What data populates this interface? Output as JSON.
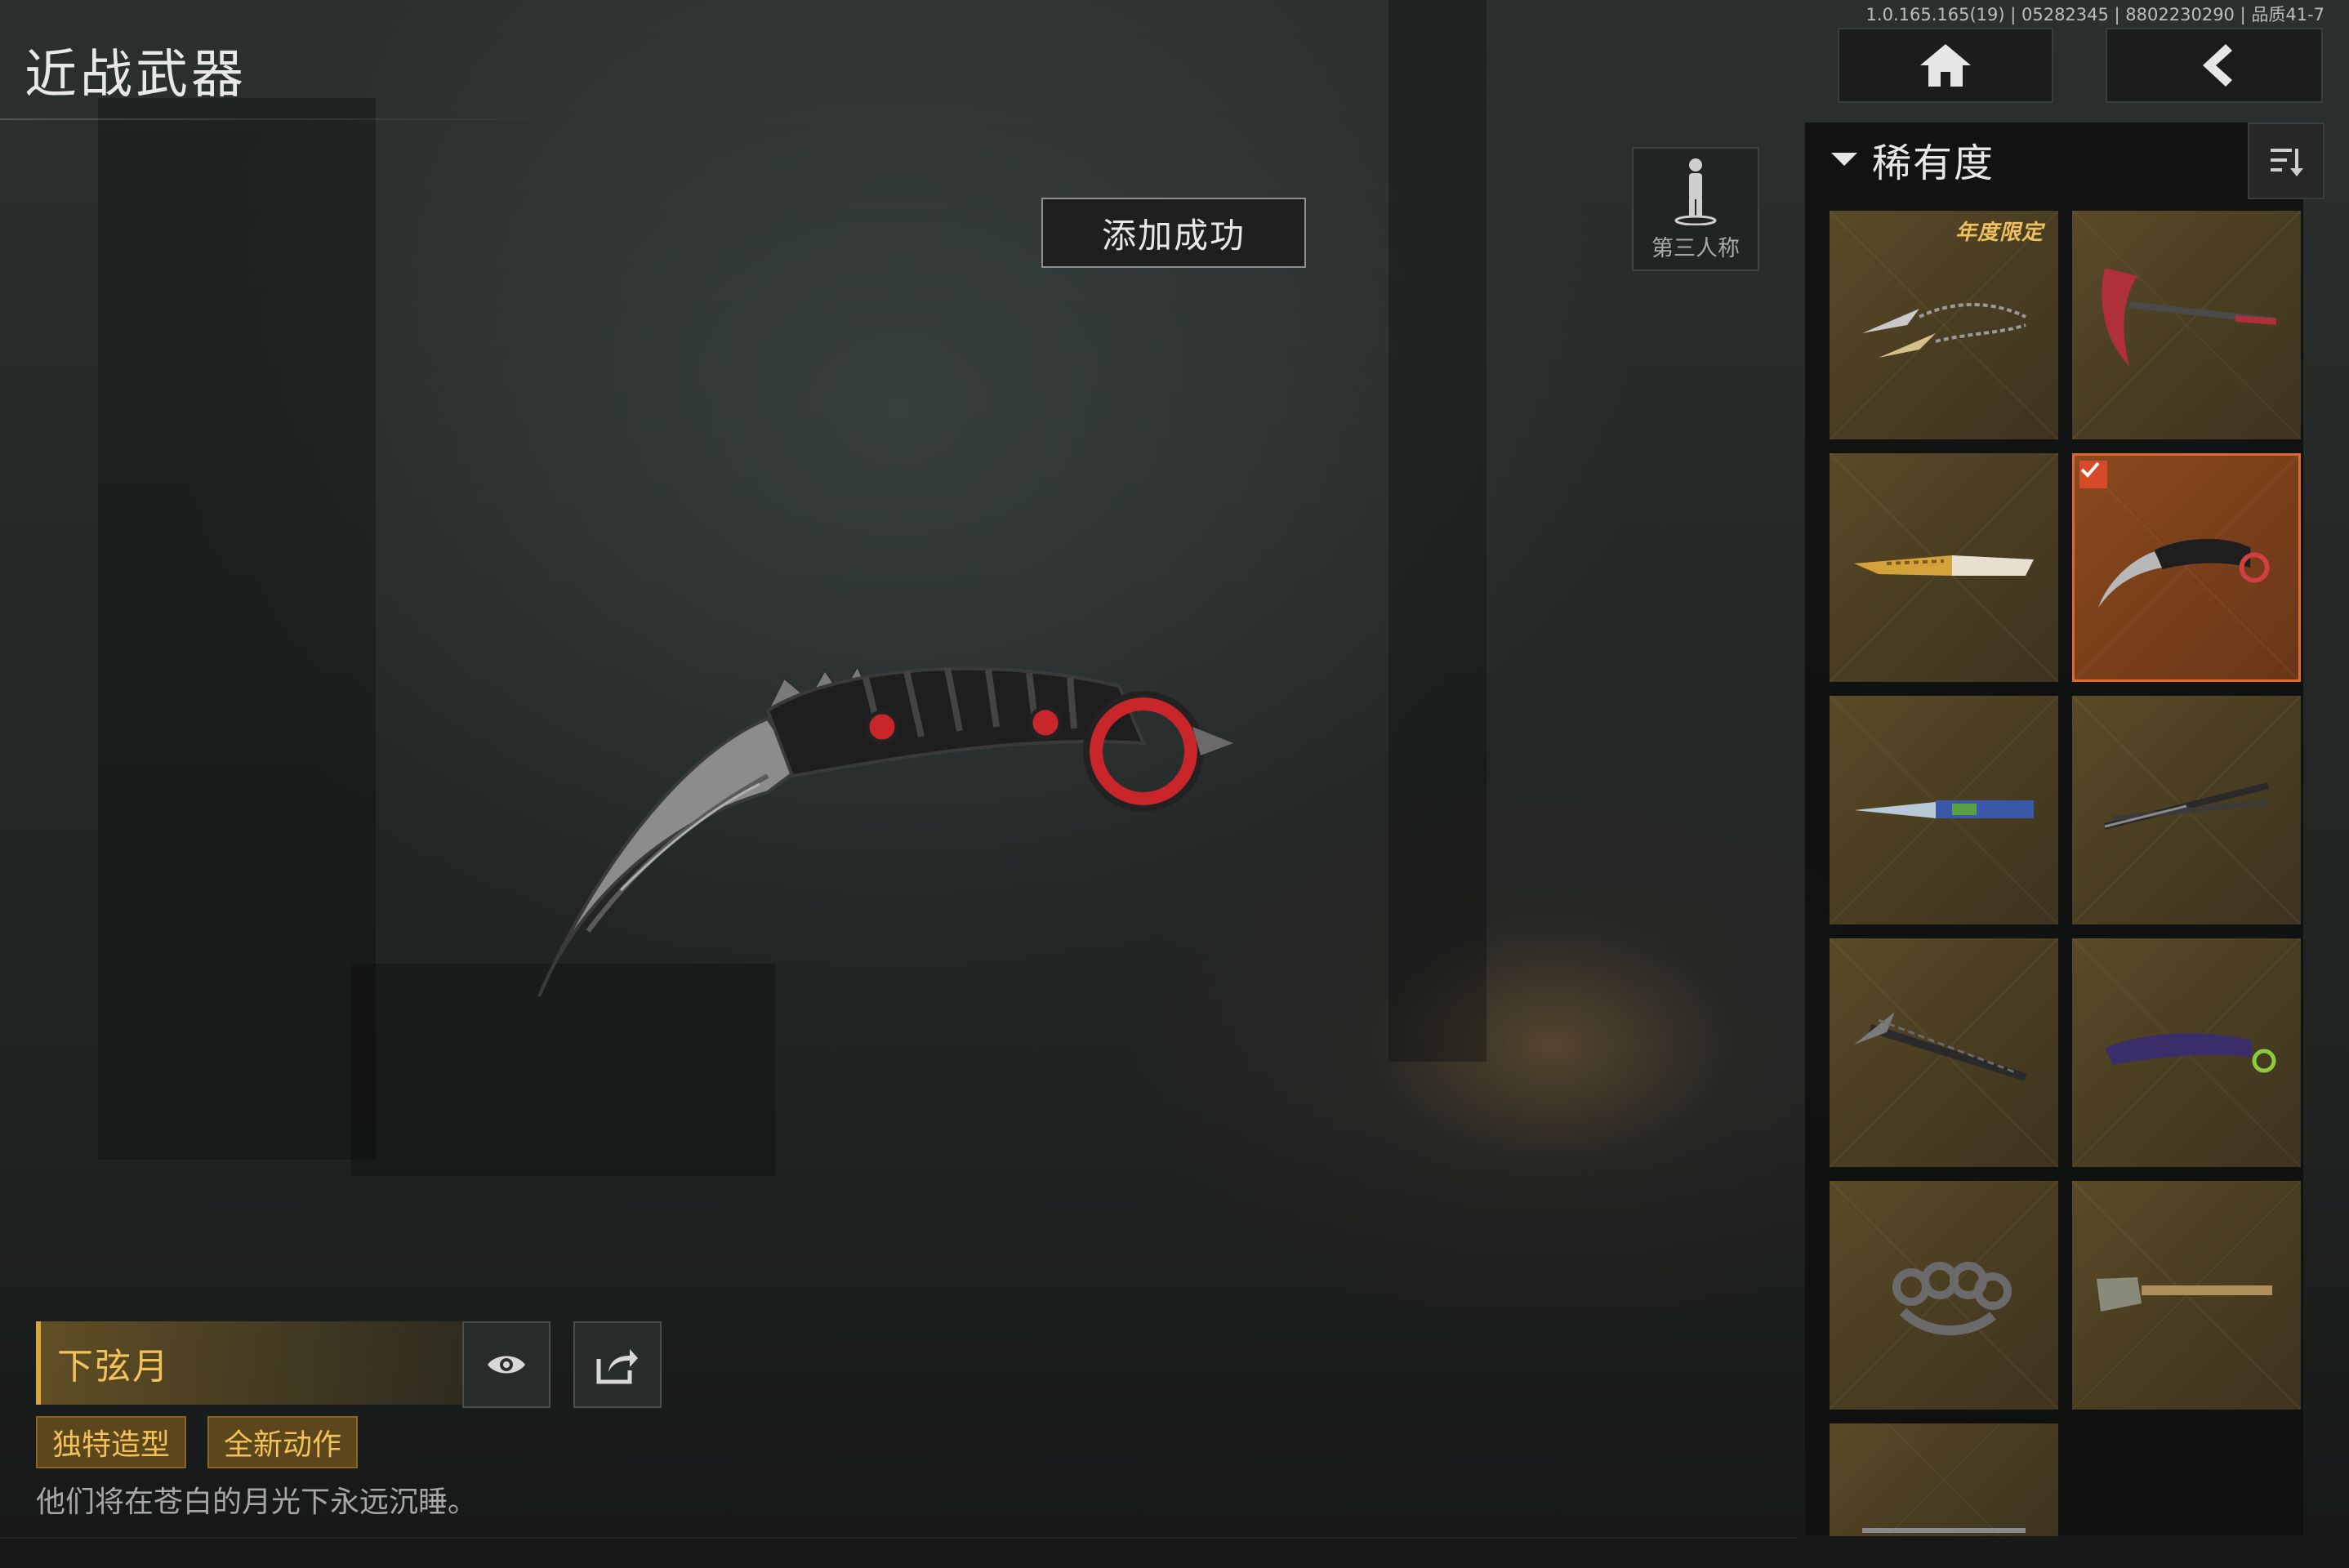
{
  "header": {
    "title": "近战武器",
    "version": "1.0.165.165(19) | 05282345 | 8802230290 | 品质41-7"
  },
  "toast": {
    "text": "添加成功"
  },
  "view_toggle": {
    "label": "第三人称"
  },
  "weapon": {
    "name": "下弦月",
    "tags": [
      "独特造型",
      "全新动作"
    ],
    "description": "他们将在苍白的月光下永远沉睡。"
  },
  "panel": {
    "filter_label": "稀有度",
    "items": [
      {
        "icon": "chain-blades-icon",
        "badge": "年度限定",
        "selected": false
      },
      {
        "icon": "red-sickle-icon",
        "selected": false
      },
      {
        "icon": "golden-knife-icon",
        "selected": false
      },
      {
        "icon": "karambit-icon",
        "selected": true
      },
      {
        "icon": "blue-dagger-icon",
        "selected": false
      },
      {
        "icon": "dual-blades-icon",
        "selected": false
      },
      {
        "icon": "ice-axe-icon",
        "selected": false
      },
      {
        "icon": "purple-karambit-icon",
        "selected": false
      },
      {
        "icon": "brass-knuckles-icon",
        "selected": false
      },
      {
        "icon": "shovel-icon",
        "selected": false
      },
      {
        "icon": "partial-item-icon",
        "selected": false
      }
    ]
  },
  "colors": {
    "accent_gold": "#f3c25a",
    "selected_orange": "#e0692a",
    "check_red": "#d64a2a",
    "tile_gold": "#4a3e22"
  }
}
